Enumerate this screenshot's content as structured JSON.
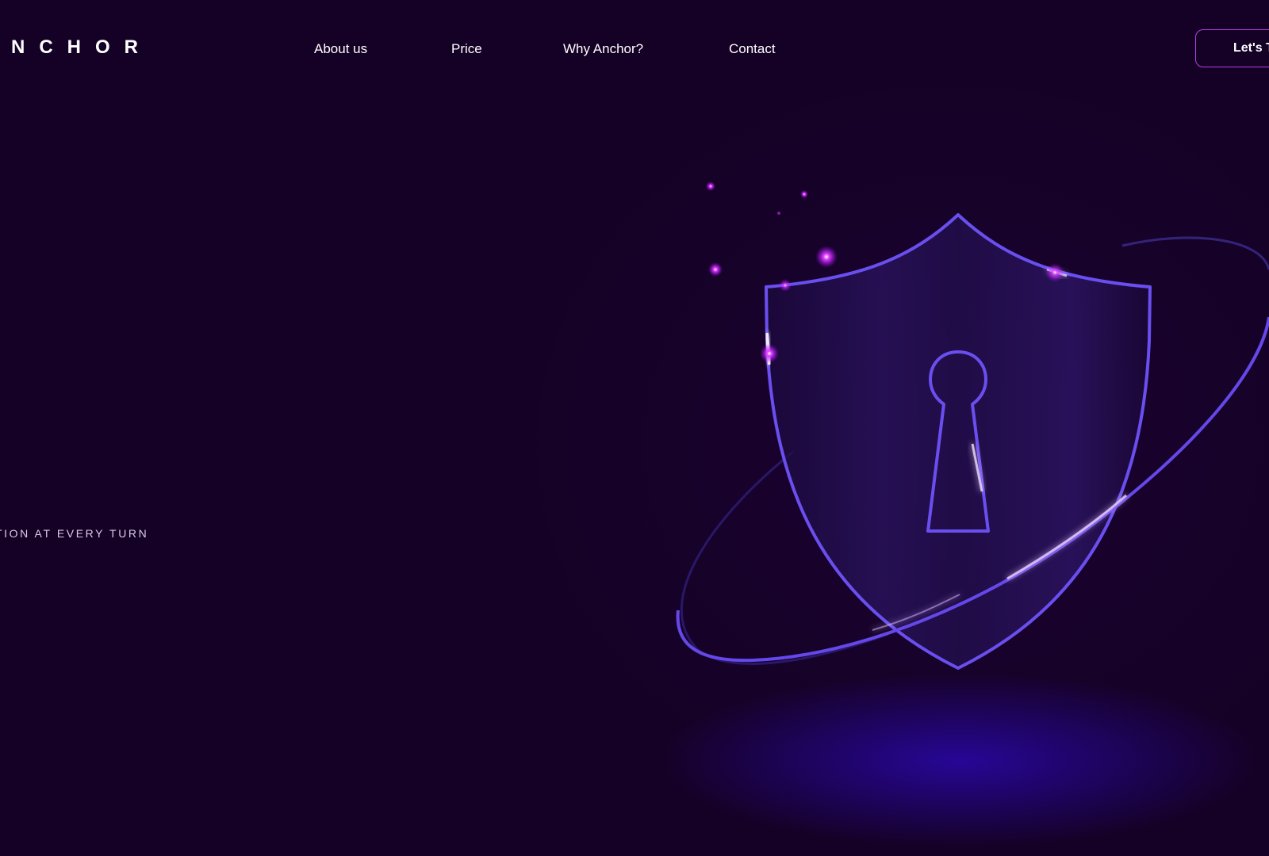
{
  "header": {
    "logo_text": "NCHOR",
    "nav": [
      {
        "label": "About us"
      },
      {
        "label": "Price"
      },
      {
        "label": "Why Anchor?"
      },
      {
        "label": "Contact"
      }
    ],
    "cta_label": "Let's T"
  },
  "hero": {
    "tagline": "TION AT EVERY TURN"
  },
  "illustration": {
    "icon": "shield-keyhole-icon",
    "accent_color": "#6a4ff0",
    "glow_color": "#c020ff",
    "background_color": "#150125"
  }
}
